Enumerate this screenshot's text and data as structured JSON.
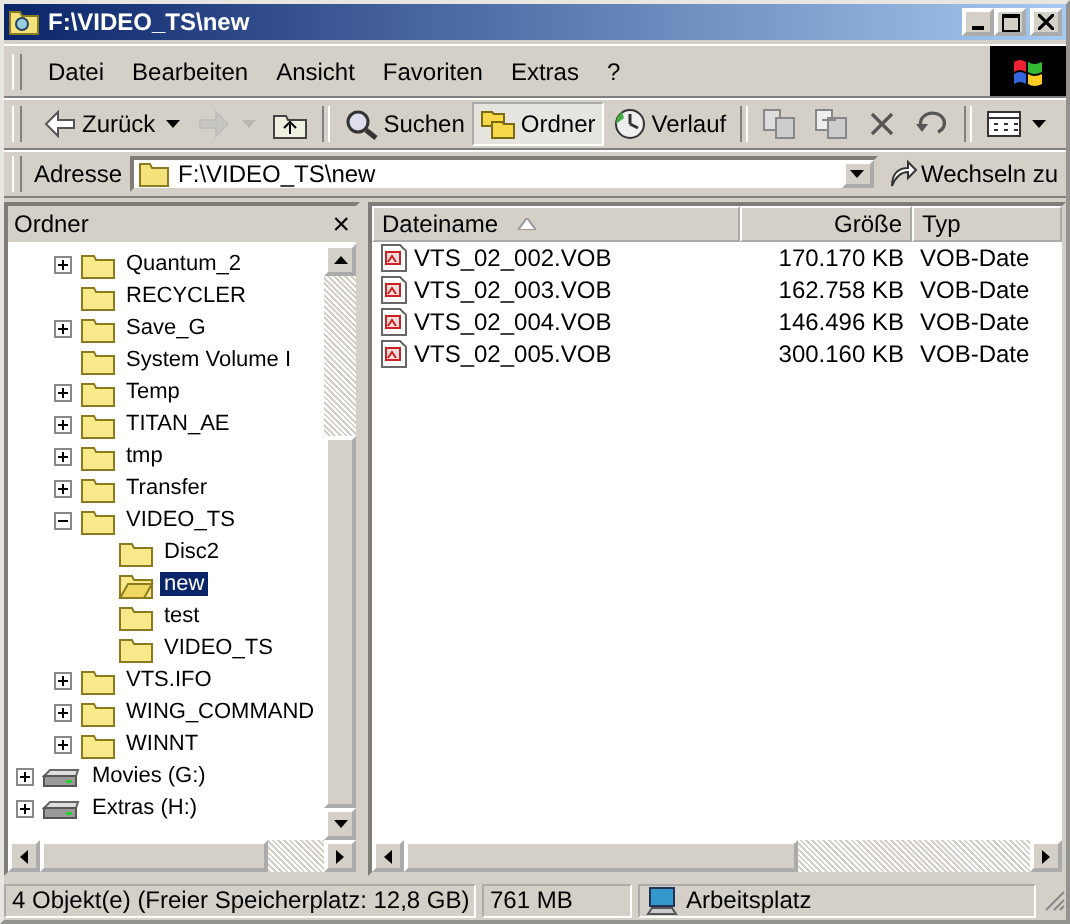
{
  "window": {
    "title": "F:\\VIDEO_TS\\new"
  },
  "menu": [
    "Datei",
    "Bearbeiten",
    "Ansicht",
    "Favoriten",
    "Extras",
    "?"
  ],
  "toolbar": [
    {
      "kind": "back",
      "label": "Zurück",
      "dropdown": true,
      "disabled": false,
      "pressed": false
    },
    {
      "kind": "forward",
      "dropdown": true,
      "disabled": true,
      "pressed": false
    },
    {
      "kind": "up",
      "dropdown": false,
      "disabled": false,
      "pressed": false
    },
    {
      "kind": "search",
      "label": "Suchen",
      "dropdown": false,
      "disabled": false,
      "pressed": false
    },
    {
      "kind": "folders",
      "label": "Ordner",
      "dropdown": false,
      "disabled": false,
      "pressed": true
    },
    {
      "kind": "history",
      "label": "Verlauf",
      "dropdown": false,
      "disabled": false,
      "pressed": false
    },
    {
      "kind": "move",
      "dropdown": false,
      "disabled": false,
      "pressed": false
    },
    {
      "kind": "copy",
      "dropdown": false,
      "disabled": false,
      "pressed": false
    },
    {
      "kind": "delete",
      "dropdown": false,
      "disabled": false,
      "pressed": false
    },
    {
      "kind": "undo",
      "dropdown": false,
      "disabled": false,
      "pressed": false
    },
    {
      "kind": "views",
      "dropdown": true,
      "disabled": false,
      "pressed": false
    }
  ],
  "address": {
    "label": "Adresse",
    "value": "F:\\VIDEO_TS\\new",
    "go": "Wechseln zu"
  },
  "folder_pane": {
    "title": "Ordner",
    "close": "×"
  },
  "tree": [
    {
      "children": [
        {
          "label": "Quantum_2",
          "kind": "folder",
          "expanded": false,
          "selected": false
        },
        {
          "label": "RECYCLER",
          "kind": "folder",
          "selected": false
        },
        {
          "label": "Save_G",
          "kind": "folder",
          "expanded": false,
          "selected": false
        },
        {
          "label": "System Volume I",
          "kind": "folder",
          "selected": false
        },
        {
          "label": "Temp",
          "kind": "folder",
          "expanded": false,
          "selected": false
        },
        {
          "label": "TITAN_AE",
          "kind": "folder",
          "expanded": false,
          "selected": false
        },
        {
          "label": "tmp",
          "kind": "folder",
          "expanded": false,
          "selected": false
        },
        {
          "label": "Transfer",
          "kind": "folder",
          "expanded": false,
          "selected": false
        },
        {
          "label": "VIDEO_TS",
          "kind": "folder",
          "expanded": true,
          "selected": false,
          "children": [
            {
              "label": "Disc2",
              "kind": "folder",
              "selected": false
            },
            {
              "label": "new",
              "kind": "folder",
              "selected": true
            },
            {
              "label": "test",
              "kind": "folder",
              "selected": false
            },
            {
              "label": "VIDEO_TS",
              "kind": "folder",
              "selected": false
            }
          ]
        },
        {
          "label": "VTS.IFO",
          "kind": "folder",
          "expanded": false,
          "selected": false
        },
        {
          "label": "WING_COMMAND",
          "kind": "folder",
          "expanded": false,
          "selected": false
        },
        {
          "label": "WINNT",
          "kind": "folder",
          "expanded": false,
          "selected": false
        }
      ]
    },
    {
      "label": "Movies (G:)",
      "kind": "drive",
      "expanded": false,
      "selected": false
    },
    {
      "label": "Extras (H:)",
      "kind": "drive",
      "expanded": false,
      "selected": false
    }
  ],
  "table": {
    "columns": [
      {
        "label": "Dateiname",
        "sorted": true
      },
      {
        "label": "Größe"
      },
      {
        "label": "Typ"
      }
    ],
    "rows": [
      {
        "name": "VTS_02_002.VOB",
        "size": "170.170 KB",
        "type": "VOB-Date",
        "selected": false
      },
      {
        "name": "VTS_02_003.VOB",
        "size": "162.758 KB",
        "type": "VOB-Date",
        "selected": false
      },
      {
        "name": "VTS_02_004.VOB",
        "size": "146.496 KB",
        "type": "VOB-Date",
        "selected": false
      },
      {
        "name": "VTS_02_005.VOB",
        "size": "300.160 KB",
        "type": "VOB-Date",
        "selected": false
      }
    ]
  },
  "status_bar": {
    "objects": "4 Objekt(e) (Freier Speicherplatz: 12,8 GB)",
    "size": "761 MB",
    "zone": "Arbeitsplatz"
  }
}
